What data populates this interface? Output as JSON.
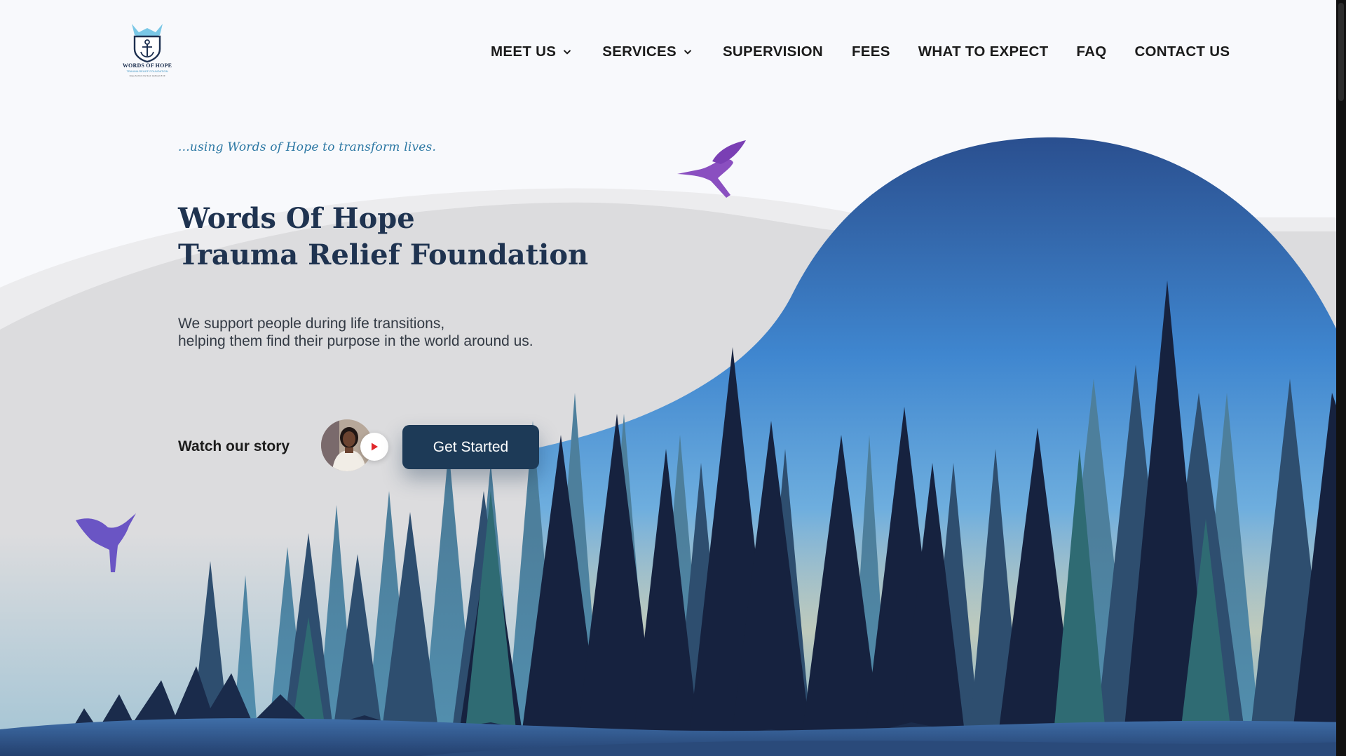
{
  "logo": {
    "name": "WORDS OF HOPE",
    "subname": "TRAUMA RELIEF FOUNDATION",
    "motto": "Hope Anchors the Soul. Hebrews 6:19",
    "icon": "anchor-shield-icon"
  },
  "nav": {
    "items": [
      {
        "label": "MEET US",
        "dropdown": true
      },
      {
        "label": "SERVICES",
        "dropdown": true
      },
      {
        "label": "SUPERVISION",
        "dropdown": false
      },
      {
        "label": "FEES",
        "dropdown": false
      },
      {
        "label": "WHAT TO EXPECT",
        "dropdown": false
      },
      {
        "label": "FAQ",
        "dropdown": false
      },
      {
        "label": "CONTACT US",
        "dropdown": false
      }
    ]
  },
  "hero": {
    "tagline": "...using Words of Hope to transform lives.",
    "title_line1": "Words Of Hope",
    "title_line2": "Trauma Relief Foundation",
    "subtitle_line1": "We support people during life transitions,",
    "subtitle_line2": "helping them find their purpose in the world around us.",
    "watch_label": "Watch our story",
    "cta_label": "Get Started"
  },
  "colors": {
    "background": "#f8f9fc",
    "accent_dark": "#1d3a57",
    "heading": "#1f3350",
    "hummingbird_top": "#8a4fc0",
    "hummingbird_bottom": "#6a55c4",
    "play": "#e0272b"
  }
}
